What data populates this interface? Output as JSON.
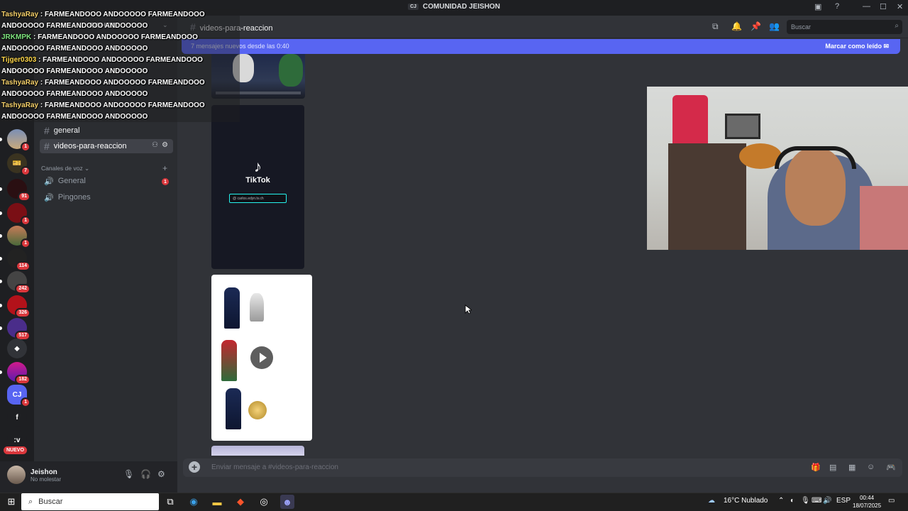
{
  "window": {
    "title": "COMUNIDAD JEISHON",
    "title_icon": "CJ"
  },
  "header": {
    "channel_name": "videos-para-reaccion",
    "search_placeholder": "Buscar"
  },
  "new_messages_bar": {
    "text": "7 mensajes nuevos desde las 0:40",
    "mark_read": "Marcar como leído"
  },
  "server_rail": {
    "badges": [
      "1",
      "1",
      "7",
      "91",
      "1",
      "1",
      "114",
      "242",
      "326",
      "517",
      "182",
      "1"
    ],
    "cj_label": "CJ",
    "f_label": "f",
    "v_label": ":v",
    "nuevo_label": "NUEVO"
  },
  "sidebar": {
    "server_name_partial": "EISHON",
    "channels": [
      {
        "name": "general"
      },
      {
        "name": "videos-para-reaccion",
        "active": true
      }
    ],
    "voice_category": "Canales de voz",
    "voice_channels": [
      {
        "name": "General",
        "badge": "1"
      },
      {
        "name": "Pingones"
      }
    ]
  },
  "user": {
    "name": "Jeishon",
    "status": "No molestar"
  },
  "media": {
    "tiktok_label": "TikTok",
    "tiktok_handle": "@ carlos.edyn.tv.ch"
  },
  "composer": {
    "placeholder": "Enviar mensaje a #videos-para-reaccion"
  },
  "chat_overlay": [
    {
      "user": "TashyaRay",
      "text": ": FARMEANDOOO ANDOOOOO FARMEANDOOO ANDOOOOO FARMEANDOOO ANDOOOOO"
    },
    {
      "user": "JRKMPK",
      "text": ": FARMEANDOOO ANDOOOOO FARMEANDOOO ANDOOOOO FARMEANDOOO ANDOOOOO"
    },
    {
      "user": "Tijger0303",
      "text": ": FARMEANDOOO ANDOOOOO FARMEANDOOO ANDOOOOO FARMEANDOOO ANDOOOOO"
    },
    {
      "user": "TashyaRay",
      "text": ": FARMEANDOOO ANDOOOOO FARMEANDOOO ANDOOOOO FARMEANDOOO ANDOOOOO"
    },
    {
      "user": "TashyaRay",
      "text": ": FARMEANDOOO ANDOOOOO FARMEANDOOO ANDOOOOO FARMEANDOOO ANDOOOOO"
    }
  ],
  "taskbar": {
    "search_label": "Buscar",
    "weather": "16°C  Nublado",
    "lang": "ESP",
    "time": "00:44",
    "date": "18/07/2025"
  },
  "colors": {
    "accent": "#5865f2",
    "badge": "#da373c"
  }
}
